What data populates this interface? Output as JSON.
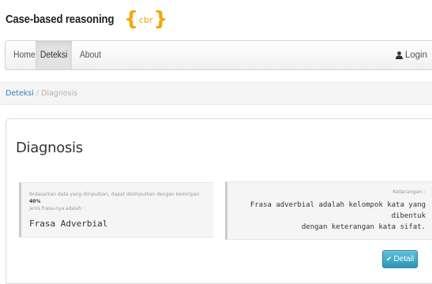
{
  "brand": {
    "title": "Case-based reasoning",
    "brace_open": "{",
    "abbr": "cbr",
    "brace_close": "}"
  },
  "nav": {
    "items": [
      {
        "label": "Home"
      },
      {
        "label": "Deteksi",
        "active": true
      },
      {
        "label": "About"
      }
    ],
    "login_label": "Login"
  },
  "breadcrumb": {
    "link": "Deteksi",
    "separator": "/",
    "current": "Diagnosis"
  },
  "main": {
    "title": "Diagnosis",
    "result": {
      "description_prefix": "Brdasarkan data yang diinputkan, dapat disimpulkan dengan kemiripan",
      "similarity": "40%",
      "description_suffix": "jenis frasa-nya adalah :",
      "value": "Frasa Adverbial"
    },
    "info": {
      "label": "Keterangan :",
      "line1": "Frasa adverbial adalah kelompok kata yang dibentuk",
      "line2": "dengan keterangan kata sifat."
    },
    "detail_button": {
      "label": "Detail",
      "icon": "check-icon"
    }
  },
  "colors": {
    "accent": "#f4a600",
    "link": "#2a7fc1",
    "button": "#49afcd"
  }
}
